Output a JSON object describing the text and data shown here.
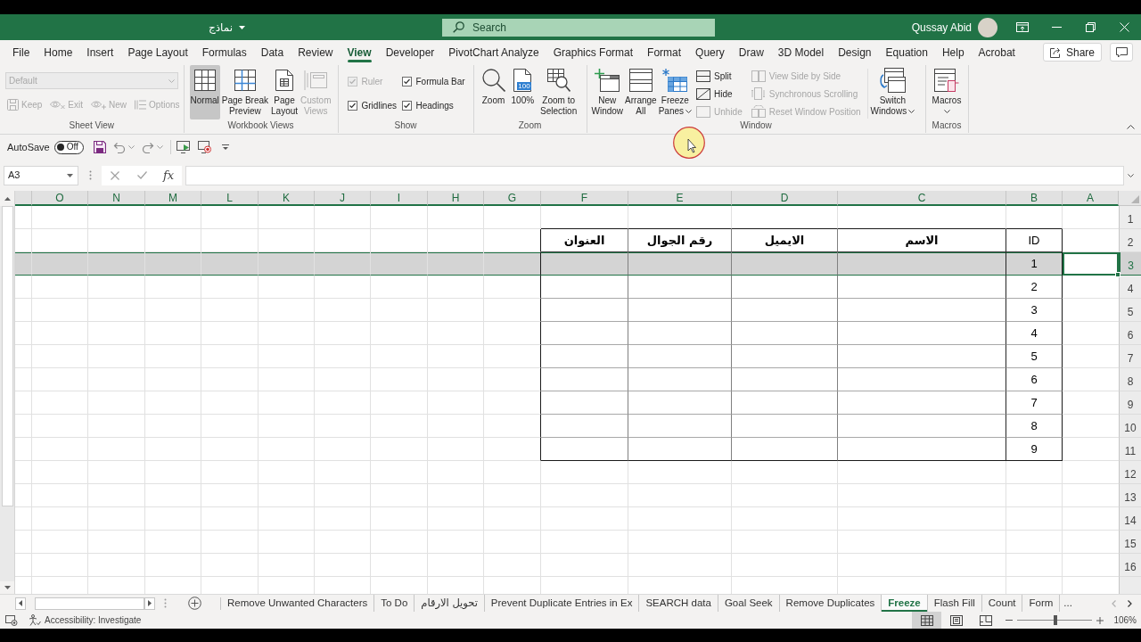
{
  "title_bar": {
    "file_name": "نماذج",
    "search": {
      "placeholder": "Search"
    },
    "user_name": "Qussay Abid"
  },
  "ribbon": {
    "tabs": [
      {
        "label": "File",
        "selected": false
      },
      {
        "label": "Home",
        "selected": false
      },
      {
        "label": "Insert",
        "selected": false
      },
      {
        "label": "Page Layout",
        "selected": false
      },
      {
        "label": "Formulas",
        "selected": false
      },
      {
        "label": "Data",
        "selected": false
      },
      {
        "label": "Review",
        "selected": false
      },
      {
        "label": "View",
        "selected": true
      },
      {
        "label": "Developer",
        "selected": false
      },
      {
        "label": "PivotChart Analyze",
        "selected": false
      },
      {
        "label": "Graphics Format",
        "selected": false
      },
      {
        "label": "Format",
        "selected": false
      },
      {
        "label": "Query",
        "selected": false
      },
      {
        "label": "Draw",
        "selected": false
      },
      {
        "label": "3D Model",
        "selected": false
      },
      {
        "label": "Design",
        "selected": false
      },
      {
        "label": "Equation",
        "selected": false
      },
      {
        "label": "Help",
        "selected": false
      },
      {
        "label": "Acrobat",
        "selected": false
      }
    ],
    "share_label": "Share",
    "sheet_view": {
      "label": "Sheet View",
      "view": {
        "value": "Default",
        "disabled": true
      },
      "buttons": [
        {
          "label": "Keep",
          "disabled": true
        },
        {
          "label": "Exit",
          "disabled": true
        },
        {
          "label": "New",
          "disabled": true
        },
        {
          "label": "Options",
          "disabled": true
        }
      ]
    },
    "workbook_views": {
      "label": "Workbook Views",
      "buttons": [
        {
          "label": "Normal",
          "selected": true,
          "disabled": false
        },
        {
          "label": "Page Break\nPreview",
          "selected": false,
          "disabled": false
        },
        {
          "label": "Page\nLayout",
          "selected": false,
          "disabled": false
        },
        {
          "label": "Custom\nViews",
          "selected": false,
          "disabled": true
        }
      ]
    },
    "show": {
      "label": "Show",
      "options": [
        {
          "label": "Ruler",
          "checked": true,
          "disabled": true
        },
        {
          "label": "Formula Bar",
          "checked": true,
          "disabled": false
        },
        {
          "label": "Gridlines",
          "checked": true,
          "disabled": false
        },
        {
          "label": "Headings",
          "checked": true,
          "disabled": false
        }
      ]
    },
    "zoom": {
      "label": "Zoom",
      "buttons": [
        {
          "label": "Zoom"
        },
        {
          "label": "100%",
          "badge": "100"
        },
        {
          "label": "Zoom to\nSelection"
        }
      ]
    },
    "window": {
      "label": "Window",
      "large_buttons": [
        {
          "label": "New\nWindow",
          "menu": false
        },
        {
          "label": "Arrange\nAll",
          "menu": false
        },
        {
          "label": "Freeze\nPanes",
          "menu": true
        }
      ],
      "small_buttons": [
        {
          "label": "Split",
          "disabled": false
        },
        {
          "label": "Hide",
          "disabled": false
        },
        {
          "label": "Unhide",
          "disabled": true
        }
      ],
      "compare_buttons": [
        {
          "label": "View Side by Side",
          "disabled": true
        },
        {
          "label": "Synchronous Scrolling",
          "disabled": true
        },
        {
          "label": "Reset Window Position",
          "disabled": true
        }
      ],
      "switch_button": {
        "label": "Switch\nWindows",
        "menu": true
      }
    },
    "macros": {
      "label": "Macros",
      "button": {
        "label": "Macros",
        "menu": true
      }
    }
  },
  "quick_access": {
    "autosave_label": "AutoSave",
    "autosave": {
      "on": false,
      "state_label": "Off"
    }
  },
  "formula_bar": {
    "name_box": "A3",
    "function_label": "fx"
  },
  "sheet": {
    "columns": [
      "O",
      "N",
      "M",
      "L",
      "K",
      "J",
      "I",
      "H",
      "G",
      "F",
      "E",
      "D",
      "C",
      "B",
      "A"
    ],
    "rows": [
      {
        "number": "1",
        "selected": false
      },
      {
        "number": "2",
        "selected": false
      },
      {
        "number": "3",
        "selected": true
      },
      {
        "number": "4",
        "selected": false
      },
      {
        "number": "5",
        "selected": false
      },
      {
        "number": "6",
        "selected": false
      },
      {
        "number": "7",
        "selected": false
      },
      {
        "number": "8",
        "selected": false
      },
      {
        "number": "9",
        "selected": false
      },
      {
        "number": "10",
        "selected": false
      },
      {
        "number": "11",
        "selected": false
      },
      {
        "number": "12",
        "selected": false
      },
      {
        "number": "13",
        "selected": false
      },
      {
        "number": "14",
        "selected": false
      },
      {
        "number": "15",
        "selected": false
      },
      {
        "number": "16",
        "selected": false
      }
    ],
    "table": {
      "columns": [
        "ID",
        "الاسم",
        "الايميل",
        "رقم الجوال",
        "العنوان"
      ],
      "rows": [
        {
          "id": "1"
        },
        {
          "id": "2"
        },
        {
          "id": "3"
        },
        {
          "id": "4"
        },
        {
          "id": "5"
        },
        {
          "id": "6"
        },
        {
          "id": "7"
        },
        {
          "id": "8"
        },
        {
          "id": "9"
        }
      ]
    }
  },
  "sheet_tabs": {
    "tabs": [
      {
        "label": "Remove Unwanted Characters",
        "selected": false
      },
      {
        "label": "To Do",
        "selected": false
      },
      {
        "label": "تحويل الارقام",
        "selected": false
      },
      {
        "label": "Prevent Duplicate Entries in Ex",
        "selected": false
      },
      {
        "label": "SEARCH data",
        "selected": false
      },
      {
        "label": "Goal Seek",
        "selected": false
      },
      {
        "label": "Remove Duplicates",
        "selected": false
      },
      {
        "label": "Freeze",
        "selected": true
      },
      {
        "label": "Flash Fill",
        "selected": false
      },
      {
        "label": "Count",
        "selected": false
      },
      {
        "label": "Form",
        "selected": false
      }
    ],
    "overflow_label": "..."
  },
  "status_bar": {
    "accessibility": "Accessibility: Investigate",
    "views": [
      {
        "kind": "normal",
        "selected": true
      },
      {
        "kind": "page_layout",
        "selected": false
      },
      {
        "kind": "page_break_preview",
        "selected": false
      }
    ],
    "zoom": {
      "level": 0.51,
      "reading": "106%"
    }
  }
}
